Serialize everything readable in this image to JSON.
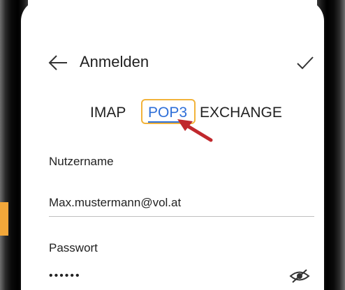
{
  "header": {
    "title": "Anmelden",
    "back_icon": "arrow-left-icon",
    "confirm_icon": "check-icon"
  },
  "tabs": [
    {
      "label": "IMAP",
      "selected": false
    },
    {
      "label": "POP3",
      "selected": true
    },
    {
      "label": "EXCHANGE",
      "selected": false
    }
  ],
  "form": {
    "username_label": "Nutzername",
    "username_value": "Max.mustermann@vol.at",
    "password_label": "Passwort",
    "password_value": "••••••",
    "visibility_icon": "eye-off-icon"
  },
  "colors": {
    "accent": "#2e6fd8",
    "highlight": "#f2b33a",
    "annotation_arrow": "#c0282d"
  }
}
